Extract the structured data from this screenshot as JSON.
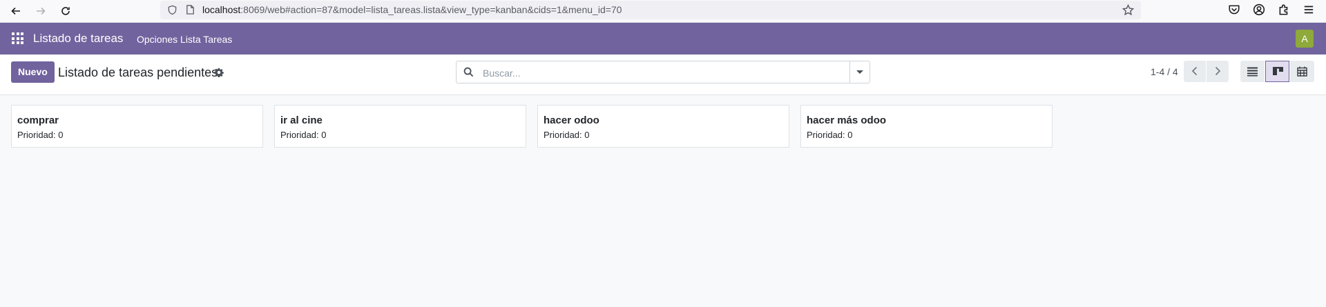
{
  "browser": {
    "url_host": "localhost",
    "url_rest": ":8069/web#action=87&model=lista_tareas.lista&view_type=kanban&cids=1&menu_id=70"
  },
  "navbar": {
    "app_name": "Listado de tareas",
    "menu_item": "Opciones Lista Tareas",
    "user_initial": "A",
    "color": "#71639e",
    "avatar_color": "#8fa93a"
  },
  "control_panel": {
    "new_button": "Nuevo",
    "title": "Listado de tareas pendientes",
    "search_placeholder": "Buscar...",
    "pager": "1-4 / 4"
  },
  "cards": [
    {
      "title": "comprar",
      "priority": "Prioridad: 0"
    },
    {
      "title": "ir al cine",
      "priority": "Prioridad: 0"
    },
    {
      "title": "hacer odoo",
      "priority": "Prioridad: 0"
    },
    {
      "title": "hacer más odoo",
      "priority": "Prioridad: 0"
    }
  ]
}
